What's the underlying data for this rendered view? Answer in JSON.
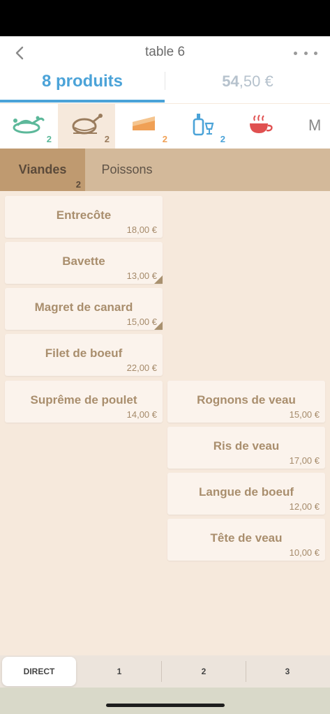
{
  "header": {
    "title": "table 6",
    "product_count": "8 produits",
    "total_int": "54",
    "total_dec": ",50 €"
  },
  "categories": [
    {
      "icon": "vegetable-plate-icon",
      "badge": "2",
      "color": "#5cb89a"
    },
    {
      "icon": "roast-chicken-icon",
      "badge": "2",
      "color": "#9a7c5d",
      "active": true
    },
    {
      "icon": "cake-slice-icon",
      "badge": "2",
      "color": "#f0a055"
    },
    {
      "icon": "wine-bottle-glass-icon",
      "badge": "2",
      "color": "#4ba3d8"
    },
    {
      "icon": "hot-cup-icon",
      "badge": "",
      "color": "#e05050"
    }
  ],
  "categories_more": "M",
  "subtabs": [
    {
      "label": "Viandes",
      "badge": "2"
    },
    {
      "label": "Poissons",
      "badge": ""
    }
  ],
  "products": [
    {
      "name": "Entrecôte",
      "price": "18,00 €"
    },
    {
      "name": "Bavette",
      "price": "13,00 €"
    },
    {
      "name": "Magret de canard",
      "price": "15,00 €"
    },
    {
      "name": "Filet de boeuf",
      "price": "22,00 €"
    },
    {
      "name": "Suprême de poulet",
      "price": "14,00 €"
    },
    {
      "name": "Rognons de veau",
      "price": "15,00 €"
    },
    {
      "name": "Ris de veau",
      "price": "17,00 €"
    },
    {
      "name": "Langue de boeuf",
      "price": "12,00 €"
    },
    {
      "name": "Tête de veau",
      "price": "10,00 €"
    }
  ],
  "bottom_segments": [
    "DIRECT",
    "1",
    "2",
    "3"
  ],
  "colors": {
    "accent": "#4ba3d8",
    "background": "#f6e9dc",
    "subtab_bar": "#d3b99a",
    "subtab_active": "#bf9a70",
    "card_text": "#a98e6d"
  }
}
